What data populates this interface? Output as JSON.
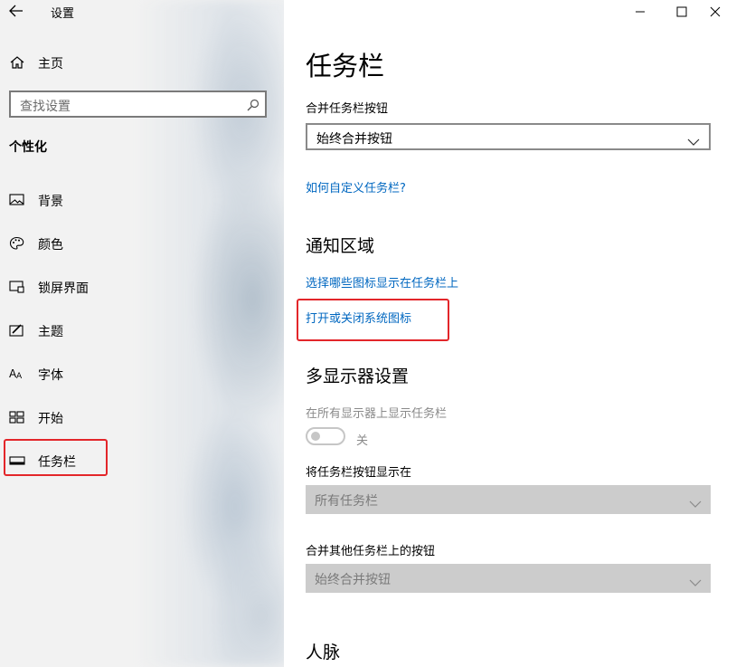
{
  "window": {
    "title": "设置",
    "controls": [
      "minimize-icon",
      "maximize-icon",
      "close-icon"
    ]
  },
  "sidebar": {
    "home_label": "主页",
    "search_placeholder": "查找设置",
    "section_title": "个性化",
    "items": [
      {
        "label": "背景",
        "icon": "picture-icon"
      },
      {
        "label": "颜色",
        "icon": "palette-icon"
      },
      {
        "label": "锁屏界面",
        "icon": "lock-screen-icon"
      },
      {
        "label": "主题",
        "icon": "theme-brush-icon"
      },
      {
        "label": "字体",
        "icon": "font-icon"
      },
      {
        "label": "开始",
        "icon": "start-tiles-icon"
      },
      {
        "label": "任务栏",
        "icon": "taskbar-icon",
        "highlighted": true
      }
    ]
  },
  "main": {
    "page_title": "任务栏",
    "combine_label": "合并任务栏按钮",
    "combine_value": "始终合并按钮",
    "customize_link": "如何自定义任务栏?",
    "notification_heading": "通知区域",
    "select_icons_link": "选择哪些图标显示在任务栏上",
    "system_icons_link": "打开或关闭系统图标",
    "multi_display_heading": "多显示器设置",
    "show_on_all_label": "在所有显示器上显示任务栏",
    "toggle_state": "关",
    "show_buttons_on_label": "将任务栏按钮显示在",
    "show_buttons_on_value": "所有任务栏",
    "combine_other_label": "合并其他任务栏上的按钮",
    "combine_other_value": "始终合并按钮",
    "people_heading": "人脉"
  },
  "colors": {
    "accent_link": "#0067c0",
    "highlight_box": "#e3262a",
    "disabled_fill": "#cccccc"
  }
}
